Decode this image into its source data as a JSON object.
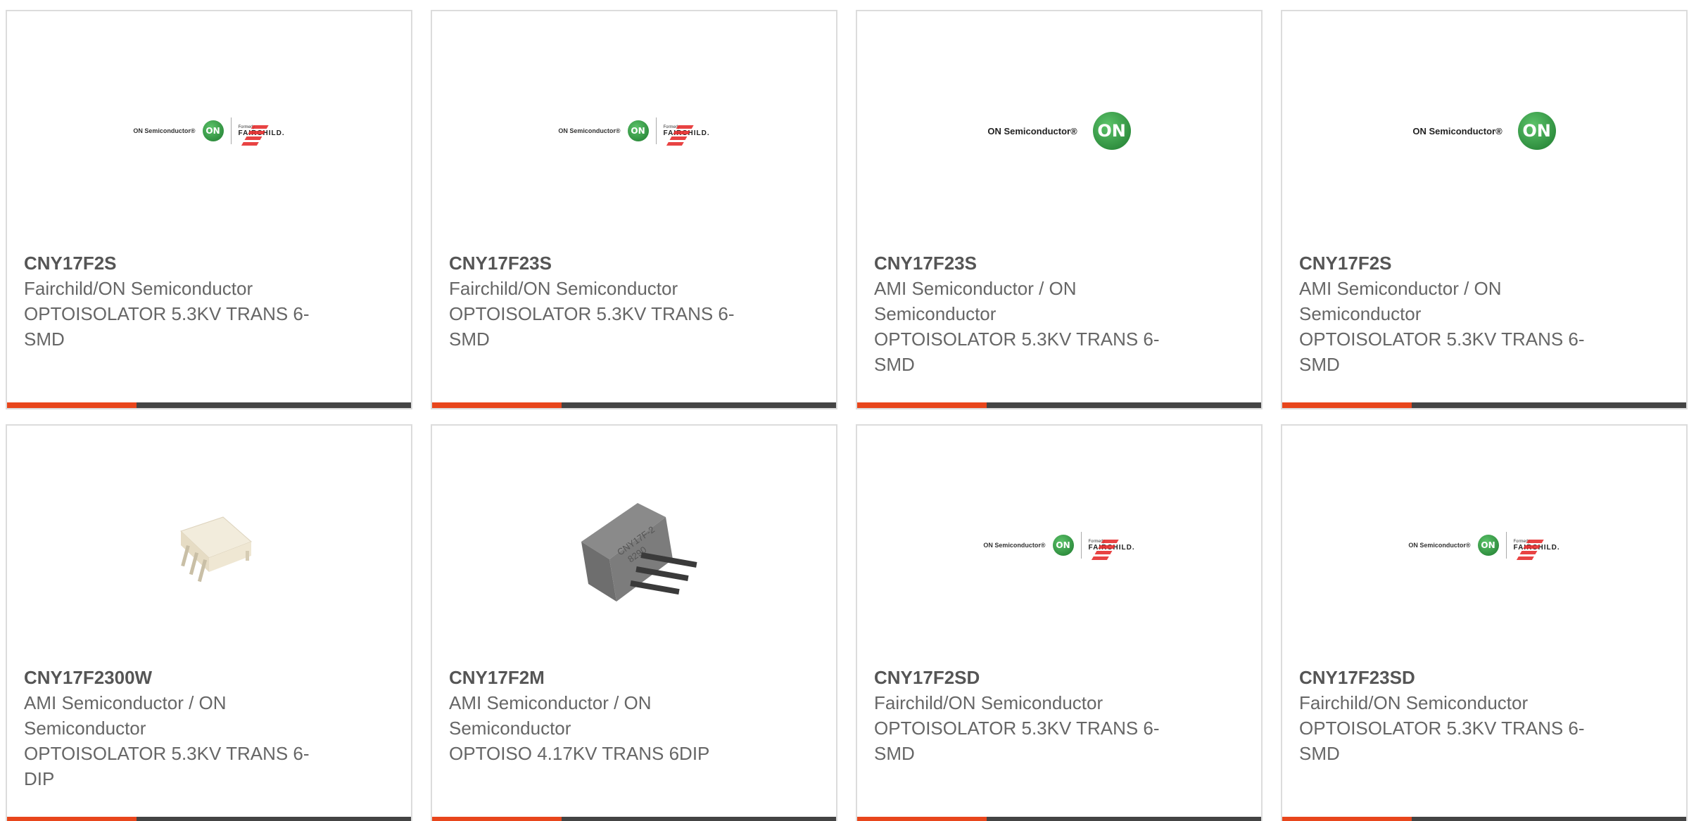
{
  "products": [
    {
      "part": "CNY17F2S",
      "manufacturer": "Fairchild/ON Semiconductor",
      "description": "OPTOISOLATOR 5.3KV TRANS 6-SMD",
      "image": "on-fairchild-logo",
      "logo_text": {
        "on": "ON Semiconductor®",
        "formerly": "Formerly",
        "brand": "FAIRCHILD."
      }
    },
    {
      "part": "CNY17F23S",
      "manufacturer": "Fairchild/ON Semiconductor",
      "description": "OPTOISOLATOR 5.3KV TRANS 6-SMD",
      "image": "on-fairchild-logo",
      "logo_text": {
        "on": "ON Semiconductor®",
        "formerly": "Formerly",
        "brand": "FAIRCHILD."
      }
    },
    {
      "part": "CNY17F23S",
      "manufacturer": "AMI Semiconductor / ON Semiconductor",
      "description": "OPTOISOLATOR 5.3KV TRANS 6-SMD",
      "image": "on-semiconductor-logo",
      "logo_text": {
        "on": "ON Semiconductor®",
        "badge": "ON"
      }
    },
    {
      "part": "CNY17F2S",
      "manufacturer": "AMI Semiconductor / ON Semiconductor",
      "description": "OPTOISOLATOR 5.3KV TRANS 6-SMD",
      "image": "on-semiconductor-logo",
      "logo_text": {
        "on": "ON Semiconductor®",
        "badge": "ON"
      }
    },
    {
      "part": "CNY17F2300W",
      "manufacturer": "AMI Semiconductor / ON Semiconductor",
      "description": "OPTOISOLATOR 5.3KV TRANS 6-DIP",
      "image": "white-dip-chip-photo"
    },
    {
      "part": "CNY17F2M",
      "manufacturer": "AMI Semiconductor / ON Semiconductor",
      "description": "OPTOISO 4.17KV TRANS 6DIP",
      "image": "gray-dip-chip-photo",
      "chip_marking": [
        "CNY17F-2",
        "8290"
      ]
    },
    {
      "part": "CNY17F2SD",
      "manufacturer": "Fairchild/ON Semiconductor",
      "description": "OPTOISOLATOR 5.3KV TRANS 6-SMD",
      "image": "on-fairchild-logo",
      "logo_text": {
        "on": "ON Semiconductor®",
        "formerly": "Formerly",
        "brand": "FAIRCHILD."
      }
    },
    {
      "part": "CNY17F23SD",
      "manufacturer": "Fairchild/ON Semiconductor",
      "description": "OPTOISOLATOR 5.3KV TRANS 6-SMD",
      "image": "on-fairchild-logo",
      "logo_text": {
        "on": "ON Semiconductor®",
        "formerly": "Formerly",
        "brand": "FAIRCHILD."
      }
    }
  ],
  "colors": {
    "accent": "#e8461c",
    "bar": "#444444",
    "border": "#dcdcdc",
    "text": "#666666"
  }
}
